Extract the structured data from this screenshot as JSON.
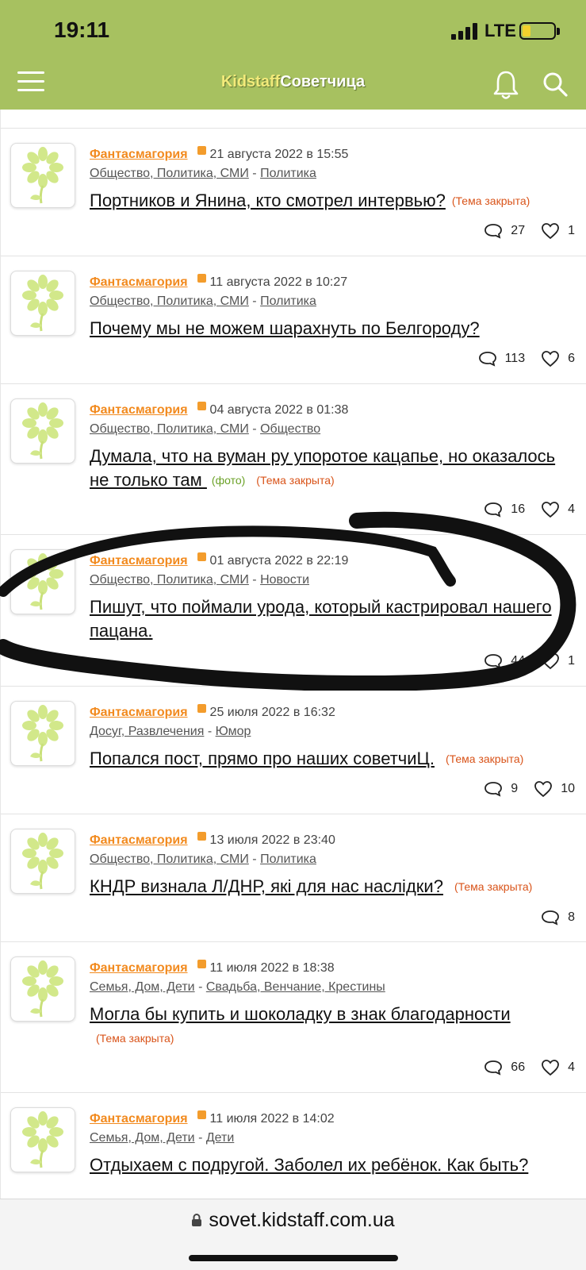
{
  "status_bar": {
    "time": "19:11",
    "network": "LTE"
  },
  "header": {
    "brand_part1": "Kidstaff",
    "brand_part2": "Советчица"
  },
  "posts": [
    {
      "author": "Фантасмагория",
      "date": "21 августа 2022 в 15:55",
      "category": "Общество, Политика, СМИ",
      "subcategory": "Политика",
      "title": "Портников и Янина, кто смотрел интервью?",
      "closed_label": "(Тема закрыта)",
      "comments": "27",
      "likes": "1"
    },
    {
      "author": "Фантасмагория",
      "date": "11 августа 2022 в 10:27",
      "category": "Общество, Политика, СМИ",
      "subcategory": "Политика",
      "title": "Почему мы не можем шарахнуть по Белгороду?",
      "comments": "113",
      "likes": "6"
    },
    {
      "author": "Фантасмагория",
      "date": "04 августа 2022 в 01:38",
      "category": "Общество, Политика, СМИ",
      "subcategory": "Общество",
      "title": "Думала, что на вуман ру упоротое кацапье, но оказалось не только там ",
      "photo_label": "(фото)",
      "closed_label": "(Тема закрыта)",
      "comments": "16",
      "likes": "4"
    },
    {
      "author": "Фантасмагория",
      "date": "01 августа 2022 в 22:19",
      "category": "Общество, Политика, СМИ",
      "subcategory": "Новости",
      "title": "Пишут, что поймали урода, который кастрировал нашего пацана.",
      "comments": "44",
      "likes": "1"
    },
    {
      "author": "Фантасмагория",
      "date": "25 июля 2022 в 16:32",
      "category": "Досуг, Развлечения",
      "subcategory": "Юмор",
      "title": "Попался пост, прямо про наших советчиЦ.",
      "closed_label": "(Тема закрыта)",
      "comments": "9",
      "likes": "10"
    },
    {
      "author": "Фантасмагория",
      "date": "13 июля 2022 в 23:40",
      "category": "Общество, Политика, СМИ",
      "subcategory": "Политика",
      "title": "КНДР визнала Л/ДНР, які для нас наслідки?",
      "closed_label": "(Тема закрыта)",
      "comments": "8"
    },
    {
      "author": "Фантасмагория",
      "date": "11 июля 2022 в 18:38",
      "category": "Семья, Дом, Дети",
      "subcategory": "Свадьба, Венчание, Крестины",
      "title": "Могла бы купить и шоколадку в знак благодарности",
      "closed_label": "(Тема закрыта)",
      "comments": "66",
      "likes": "4"
    },
    {
      "author": "Фантасмагория",
      "date": "11 июля 2022 в 14:02",
      "category": "Семья, Дом, Дети",
      "subcategory": "Дети",
      "title": "Отдыхаем с подругой. Заболел их ребёнок. Как быть?"
    }
  ],
  "url_bar": {
    "url": "sovet.kidstaff.com.ua"
  },
  "icons": [
    "menu-icon",
    "bell-icon",
    "search-icon",
    "comment-icon",
    "heart-icon",
    "lock-icon",
    "flower-avatar-icon"
  ],
  "colors": {
    "header": "#a7c160",
    "author": "#f28a1e",
    "closed": "#d9541a",
    "photo": "#6aa126"
  }
}
